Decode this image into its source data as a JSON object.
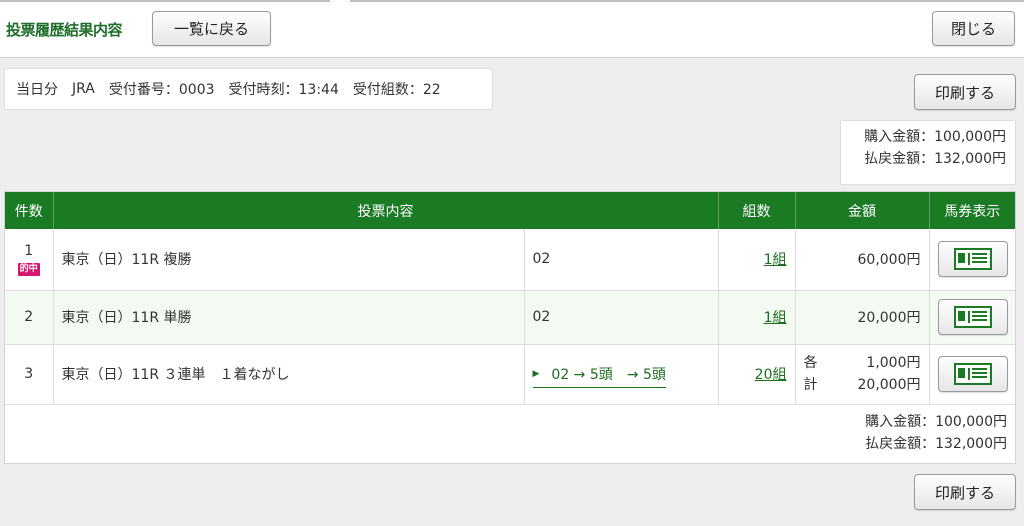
{
  "page": {
    "title": "投票履歴結果内容",
    "back_label": "一覧に戻る",
    "close_label": "閉じる",
    "print_label": "印刷する"
  },
  "info": {
    "day": "当日分",
    "org": "JRA",
    "receipt_no": "受付番号：0003",
    "receipt_time": "受付時刻：13:44",
    "receipt_sets": "受付組数：22"
  },
  "summary": {
    "purchase": "購入金額：100,000円",
    "payout": "払戻金額：132,000円"
  },
  "table": {
    "headers": [
      "件数",
      "投票内容",
      "組数",
      "金額",
      "馬券表示"
    ],
    "rows": [
      {
        "no": "1",
        "badge": "的中",
        "race": "東京（日）11R 複勝",
        "selection": "02",
        "count": "1組",
        "amount": "60,000円"
      },
      {
        "no": "2",
        "race": "東京（日）11R 単勝",
        "selection": "02",
        "count": "1組",
        "amount": "20,000円"
      },
      {
        "no": "3",
        "race": "東京（日）11R ３連単　１着ながし",
        "selection": "02 → 5頭　→ 5頭",
        "count": "20組",
        "amount_label_1": "各",
        "amount_label_2": "計",
        "amount_each": "1,000円",
        "amount_total": "20,000円"
      }
    ]
  },
  "colors": {
    "header_green": "#1b7a24",
    "title_green": "#1f6e2a",
    "hit_pink": "#d6156c"
  },
  "icons": {
    "ticket": "ticket-icon",
    "arrow": "triangle-right-icon"
  }
}
